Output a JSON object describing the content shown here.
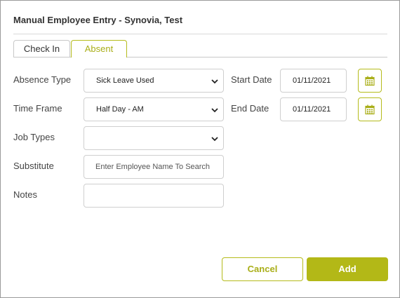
{
  "dialog": {
    "title": "Manual Employee Entry - Synovia, Test"
  },
  "tabs": [
    {
      "label": "Check In",
      "active": false
    },
    {
      "label": "Absent",
      "active": true
    }
  ],
  "form": {
    "absence_type": {
      "label": "Absence Type",
      "value": "Sick Leave Used"
    },
    "time_frame": {
      "label": "Time Frame",
      "value": "Half Day - AM"
    },
    "job_types": {
      "label": "Job Types",
      "value": ""
    },
    "substitute": {
      "label": "Substitute",
      "placeholder": "Enter Employee Name To Search"
    },
    "notes": {
      "label": "Notes",
      "value": ""
    },
    "start_date": {
      "label": "Start Date",
      "value": "01/11/2021",
      "icon": "calendar-icon"
    },
    "end_date": {
      "label": "End Date",
      "value": "01/11/2021",
      "icon": "calendar-icon"
    }
  },
  "actions": {
    "cancel_label": "Cancel",
    "add_label": "Add"
  },
  "colors": {
    "accent": "#b3b817",
    "border": "#cfcfcf",
    "text": "#333333"
  }
}
